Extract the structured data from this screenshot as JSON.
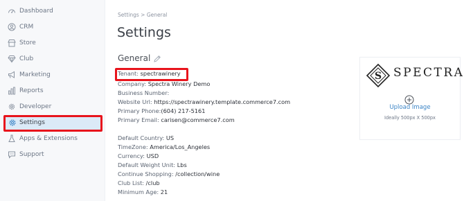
{
  "sidebar": {
    "items": [
      {
        "label": "Dashboard",
        "icon": "dashboard-icon"
      },
      {
        "label": "CRM",
        "icon": "user-circle-icon"
      },
      {
        "label": "Store",
        "icon": "store-icon"
      },
      {
        "label": "Club",
        "icon": "diamond-icon"
      },
      {
        "label": "Marketing",
        "icon": "megaphone-icon"
      },
      {
        "label": "Reports",
        "icon": "bar-chart-icon"
      },
      {
        "label": "Developer",
        "icon": "cog-icon"
      },
      {
        "label": "Settings",
        "icon": "gear-icon",
        "active": true
      },
      {
        "label": "Apps & Extensions",
        "icon": "flask-icon"
      },
      {
        "label": "Support",
        "icon": "chat-icon"
      }
    ]
  },
  "breadcrumb": "Settings > General",
  "page_title": "Settings",
  "section_title": "General",
  "fields": {
    "tenant": {
      "label": "Tenant:",
      "value": "spectrawinery"
    },
    "company": {
      "label": "Company:",
      "value": "Spectra Winery Demo"
    },
    "business_number": {
      "label": "Business Number:",
      "value": ""
    },
    "website": {
      "label": "Website Url:",
      "value": "https://spectrawinery.template.commerce7.com"
    },
    "phone": {
      "label": "Primary Phone:",
      "value": "(604) 217-5161"
    },
    "email": {
      "label": "Primary Email:",
      "value": "carisen@commerce7.com"
    },
    "country": {
      "label": "Default Country:",
      "value": "US"
    },
    "timezone": {
      "label": "TimeZone:",
      "value": "America/Los_Angeles"
    },
    "currency": {
      "label": "Currency:",
      "value": "USD"
    },
    "weight_unit": {
      "label": "Default Weight Unit:",
      "value": "Lbs"
    },
    "continue_shopping": {
      "label": "Continue Shopping:",
      "value": "/collection/wine"
    },
    "club_list": {
      "label": "Club List:",
      "value": "/club"
    },
    "minimum_age": {
      "label": "Minimum Age:",
      "value": "21"
    }
  },
  "logo_card": {
    "logo_text": "SPECTRA",
    "upload_label": "Upload Image",
    "size_hint": "Ideally 500px X 500px"
  },
  "colors": {
    "highlight": "#e8141c",
    "active_bg": "#dbeaf7",
    "link": "#3a84c6"
  }
}
